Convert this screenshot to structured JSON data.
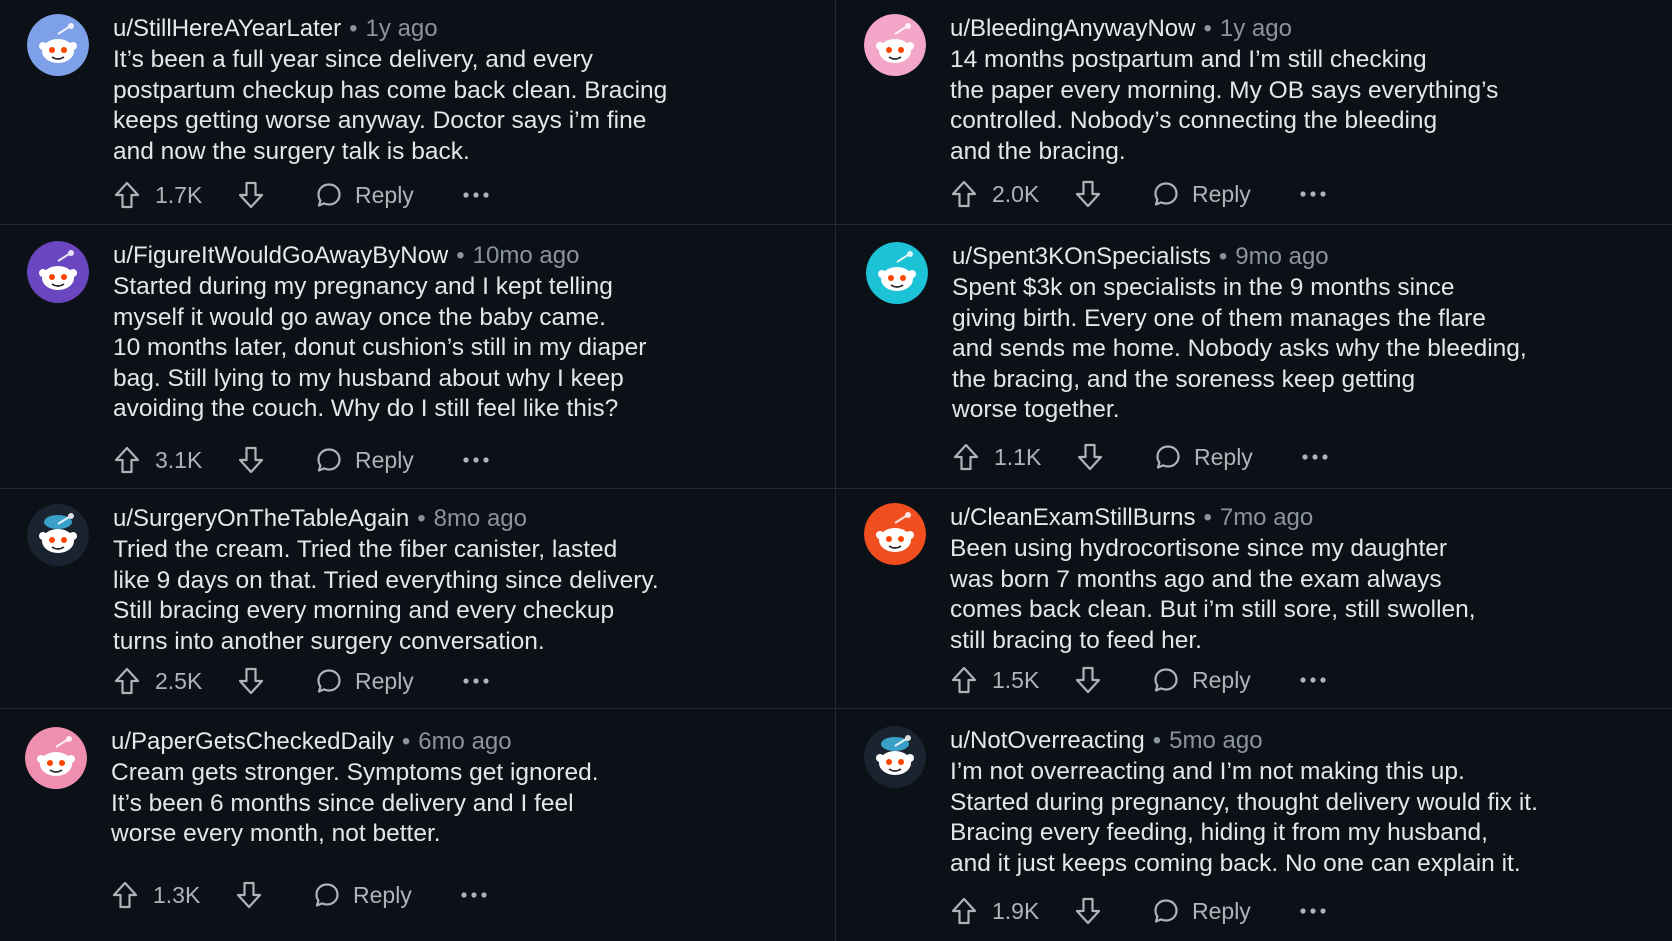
{
  "action_labels": {
    "reply": "Reply"
  },
  "comments": [
    {
      "username": "u/StillHereAYearLater",
      "time": "1y ago",
      "lines": [
        "It’s been a full year since delivery, and every",
        "postpartum checkup has come back clean. Bracing",
        "keeps getting worse anyway. Doctor says i’m fine",
        "and now the surgery talk is back."
      ],
      "votes": "1.7K",
      "avatar_color": "#7ea0e8"
    },
    {
      "username": "u/BleedingAnywayNow",
      "time": "1y ago",
      "lines": [
        "14 months postpartum and I’m still checking",
        "the paper every morning. My OB says everything’s",
        "controlled. Nobody’s connecting the bleeding",
        "and the bracing."
      ],
      "votes": "2.0K",
      "avatar_color": "#f3a6c8"
    },
    {
      "username": "u/FigureItWouldGoAwayByNow",
      "time": "10mo ago",
      "lines": [
        "Started during my pregnancy and I kept telling",
        "myself it would go away once the baby came.",
        "10 months later, donut cushion’s still in my diaper",
        "bag. Still lying to my husband about why I keep",
        "avoiding the couch. Why do I still feel like this?"
      ],
      "votes": "3.1K",
      "avatar_color": "#6b46c1"
    },
    {
      "username": "u/Spent3KOnSpecialists",
      "time": "9mo ago",
      "lines": [
        "Spent $3k on specialists in the 9 months since",
        "giving birth. Every one of them manages the flare",
        "and sends me home. Nobody asks why the bleeding,",
        "the bracing, and the soreness keep getting",
        "worse together."
      ],
      "votes": "1.1K",
      "avatar_color": "#1cc3d6"
    },
    {
      "username": "u/SurgeryOnTheTableAgain",
      "time": "8mo ago",
      "lines": [
        "Tried the cream. Tried the fiber canister, lasted",
        "like 9 days on that. Tried everything since delivery.",
        "Still bracing every morning and every checkup",
        "turns into another surgery conversation."
      ],
      "votes": "2.5K",
      "avatar_color": "#1a2330"
    },
    {
      "username": "u/CleanExamStillBurns",
      "time": "7mo ago",
      "lines": [
        "Been using hydrocortisone since my daughter",
        "was born 7 months ago and the exam always",
        "comes back clean. But i’m still sore, still swollen,",
        "still bracing to feed her."
      ],
      "votes": "1.5K",
      "avatar_color": "#f04e1f"
    },
    {
      "username": "u/PaperGetsCheckedDaily",
      "time": "6mo ago",
      "lines": [
        "Cream gets stronger. Symptoms get ignored.",
        "It’s been 6 months since delivery and I feel",
        "worse every month, not better."
      ],
      "votes": "1.3K",
      "avatar_color": "#ef8fb0"
    },
    {
      "username": "u/NotOverreacting",
      "time": "5mo ago",
      "lines": [
        "I’m not overreacting and I’m not making this up.",
        "Started during pregnancy, thought delivery would fix it.",
        "Bracing every feeding, hiding it from my husband,",
        "and it just keeps coming back. No one can explain it."
      ],
      "votes": "1.9K",
      "avatar_color": "#1a2330"
    }
  ]
}
